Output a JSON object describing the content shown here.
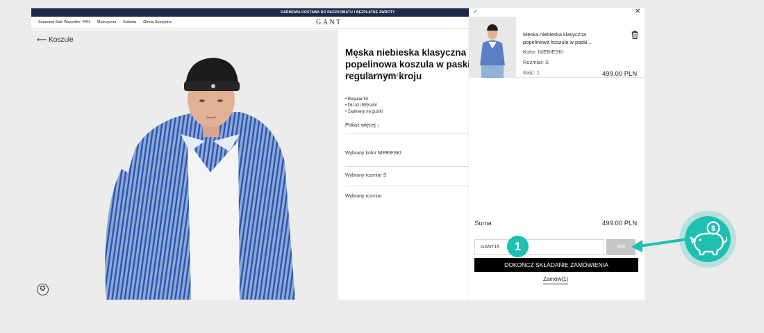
{
  "promo": {
    "text": "DARMOWA DOSTAWA DO PACZKOMATU I BEZPŁATNE ZWROTY"
  },
  "nav": {
    "links": [
      "Seasonal Sale Wszystko -40%",
      "Mężczyzna",
      "Kobieta",
      "Oferta Specjalna"
    ],
    "logo": "GANT"
  },
  "photo": {
    "back_label": "⟵ Koszule",
    "badge_icon": "✪"
  },
  "product": {
    "title": "Męska niebieska klasyczna popelinowa koszula w paski o regularnym kroju",
    "code": "Kod produktu 3000130.436",
    "features": [
      "Regular Fit",
      "DŁUGI RĘKAW",
      "Zapinany na guziki"
    ],
    "show_more": "Pokaż więcej ↓",
    "selected_color": "Wybrany kolor NIEBIESKI",
    "selected_size": "Wybrany rozmiar S",
    "size_label": "Wybrany rozmiar"
  },
  "cart": {
    "check_icon": "✓",
    "close_icon": "✕",
    "item": {
      "name": "Męska niebieska klasyczna popelinowa koszula w paski...",
      "color": "Kolor: NIEBIESKI",
      "size": "Rozmiar: S",
      "qty": "Ilość: 1",
      "price": "499.00 PLN"
    },
    "total_label": "Suma",
    "total_value": "499.00 PLN",
    "coupon_value": "GANT15",
    "apply_label": "użyj",
    "checkout_label": "DOKOŃCZ SKŁADANIE ZAMÓWIENIA",
    "order_link": "Zamów(1)"
  },
  "annotation": {
    "step_number": "1",
    "accent_color": "#1fbfb2"
  }
}
